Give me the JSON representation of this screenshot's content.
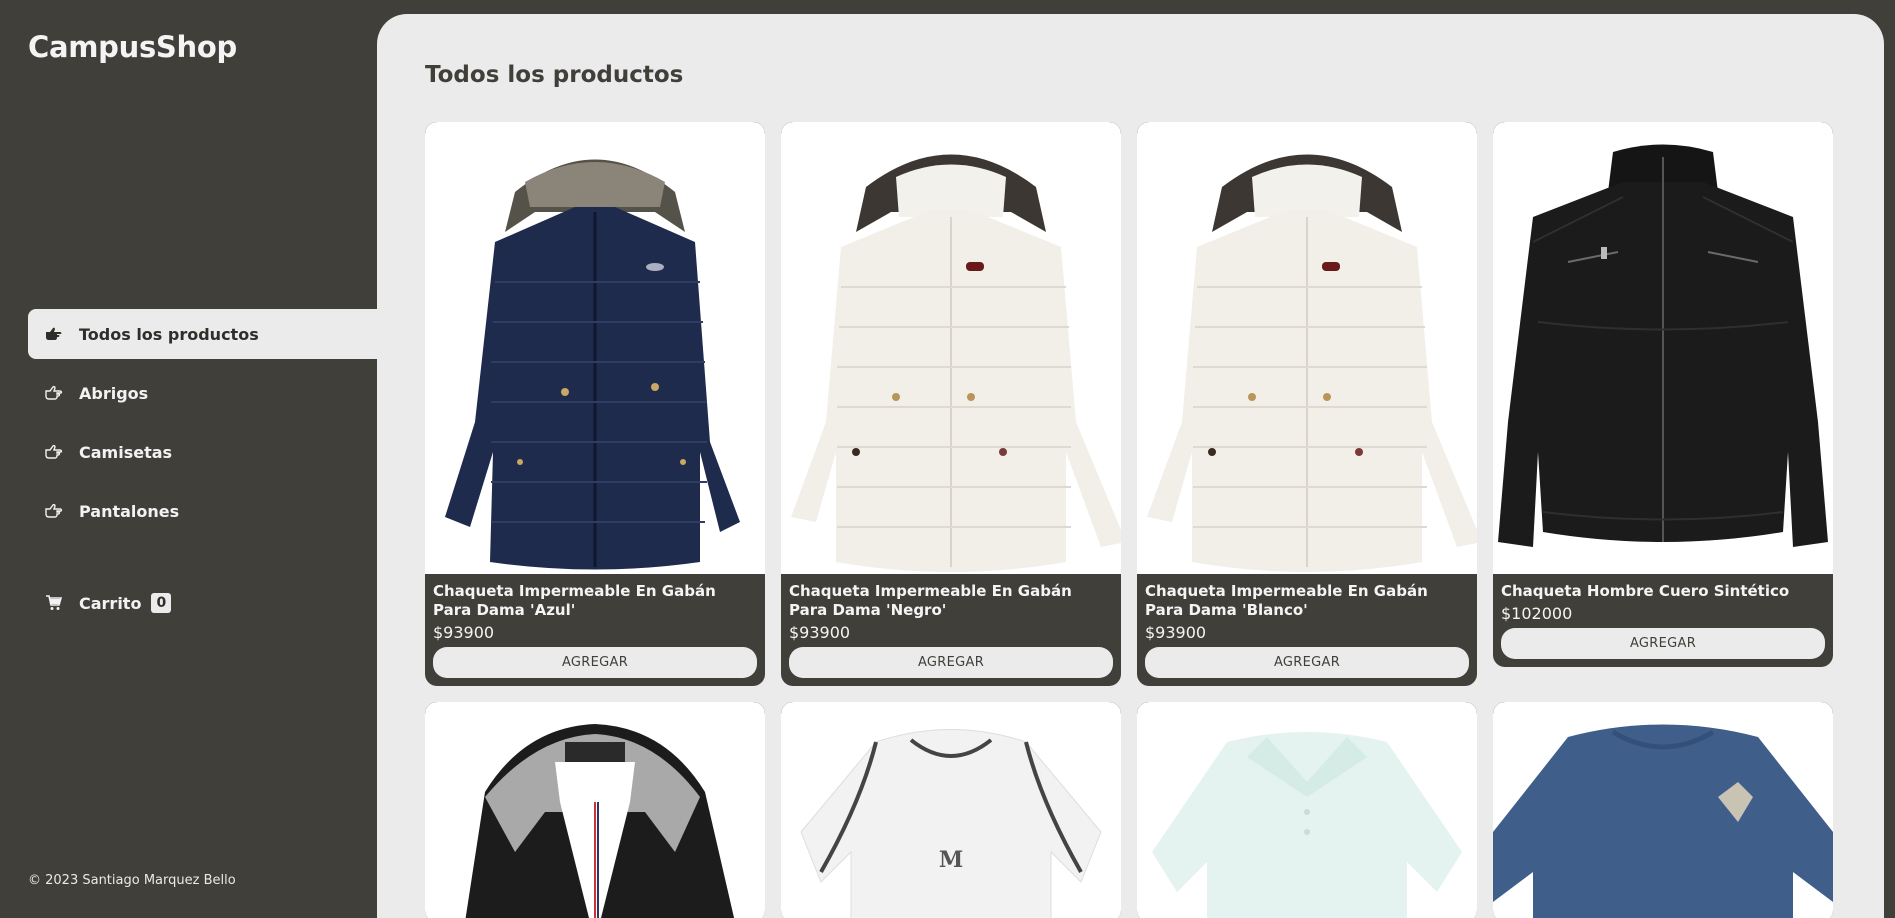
{
  "brand": {
    "name": "CampusShop"
  },
  "nav": {
    "items": [
      {
        "label": "Todos los productos",
        "icon": "pointing-hand-icon",
        "active": true
      },
      {
        "label": "Abrigos",
        "icon": "pointing-hand-outline-icon"
      },
      {
        "label": "Camisetas",
        "icon": "pointing-hand-outline-icon"
      },
      {
        "label": "Pantalones",
        "icon": "pointing-hand-outline-icon"
      }
    ]
  },
  "cart": {
    "label": "Carrito",
    "count": "0",
    "icon": "cart-icon"
  },
  "footer": {
    "text": "© 2023 Santiago Marquez Bello"
  },
  "main": {
    "title": "Todos los productos",
    "products": [
      {
        "name": "Chaqueta Impermeable En Gabán Para Dama 'Azul'",
        "price": "$93900",
        "button": "AGREGAR",
        "image": "navy-puffer-coat"
      },
      {
        "name": "Chaqueta Impermeable En Gabán Para Dama 'Negro'",
        "price": "$93900",
        "button": "AGREGAR",
        "image": "white-puffer-coat"
      },
      {
        "name": "Chaqueta Impermeable En Gabán Para Dama 'Blanco'",
        "price": "$93900",
        "button": "AGREGAR",
        "image": "white-puffer-coat"
      },
      {
        "name": "Chaqueta Hombre Cuero Sintético",
        "price": "$102000",
        "button": "AGREGAR",
        "image": "black-leather-jacket"
      },
      {
        "image": "black-hooded-jacket"
      },
      {
        "image": "white-tshirt"
      },
      {
        "image": "mint-polo-shirt"
      },
      {
        "image": "blue-tshirt"
      }
    ]
  },
  "colors": {
    "dark": "#403f3a",
    "light": "#ebebeb",
    "white": "#ffffff"
  }
}
